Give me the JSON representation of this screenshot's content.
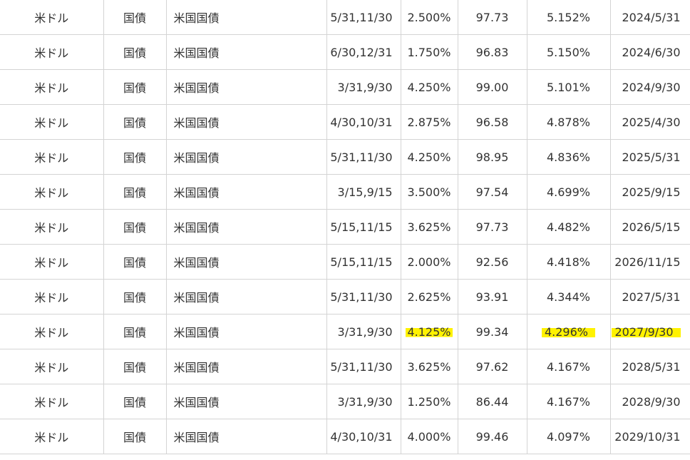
{
  "rows": [
    {
      "currency": "米ドル",
      "type": "国債",
      "name": "米国国債",
      "payment_dates": "5/31,11/30",
      "coupon": "2.500%",
      "price": "97.73",
      "yield": "5.152%",
      "maturity": "2024/5/31"
    },
    {
      "currency": "米ドル",
      "type": "国債",
      "name": "米国国債",
      "payment_dates": "6/30,12/31",
      "coupon": "1.750%",
      "price": "96.83",
      "yield": "5.150%",
      "maturity": "2024/6/30"
    },
    {
      "currency": "米ドル",
      "type": "国債",
      "name": "米国国債",
      "payment_dates": "3/31,9/30",
      "coupon": "4.250%",
      "price": "99.00",
      "yield": "5.101%",
      "maturity": "2024/9/30"
    },
    {
      "currency": "米ドル",
      "type": "国債",
      "name": "米国国債",
      "payment_dates": "4/30,10/31",
      "coupon": "2.875%",
      "price": "96.58",
      "yield": "4.878%",
      "maturity": "2025/4/30"
    },
    {
      "currency": "米ドル",
      "type": "国債",
      "name": "米国国債",
      "payment_dates": "5/31,11/30",
      "coupon": "4.250%",
      "price": "98.95",
      "yield": "4.836%",
      "maturity": "2025/5/31"
    },
    {
      "currency": "米ドル",
      "type": "国債",
      "name": "米国国債",
      "payment_dates": "3/15,9/15",
      "coupon": "3.500%",
      "price": "97.54",
      "yield": "4.699%",
      "maturity": "2025/9/15"
    },
    {
      "currency": "米ドル",
      "type": "国債",
      "name": "米国国債",
      "payment_dates": "5/15,11/15",
      "coupon": "3.625%",
      "price": "97.73",
      "yield": "4.482%",
      "maturity": "2026/5/15"
    },
    {
      "currency": "米ドル",
      "type": "国債",
      "name": "米国国債",
      "payment_dates": "5/15,11/15",
      "coupon": "2.000%",
      "price": "92.56",
      "yield": "4.418%",
      "maturity": "2026/11/15"
    },
    {
      "currency": "米ドル",
      "type": "国債",
      "name": "米国国債",
      "payment_dates": "5/31,11/30",
      "coupon": "2.625%",
      "price": "93.91",
      "yield": "4.344%",
      "maturity": "2027/5/31"
    },
    {
      "currency": "米ドル",
      "type": "国債",
      "name": "米国国債",
      "payment_dates": "3/31,9/30",
      "coupon": "4.125%",
      "price": "99.34",
      "yield": "4.296%",
      "maturity": "2027/9/30",
      "highlighted": true
    },
    {
      "currency": "米ドル",
      "type": "国債",
      "name": "米国国債",
      "payment_dates": "5/31,11/30",
      "coupon": "3.625%",
      "price": "97.62",
      "yield": "4.167%",
      "maturity": "2028/5/31"
    },
    {
      "currency": "米ドル",
      "type": "国債",
      "name": "米国国債",
      "payment_dates": "3/31,9/30",
      "coupon": "1.250%",
      "price": "86.44",
      "yield": "4.167%",
      "maturity": "2028/9/30"
    },
    {
      "currency": "米ドル",
      "type": "国債",
      "name": "米国国債",
      "payment_dates": "4/30,10/31",
      "coupon": "4.000%",
      "price": "99.46",
      "yield": "4.097%",
      "maturity": "2029/10/31"
    }
  ],
  "highlight_color": "#fff200"
}
